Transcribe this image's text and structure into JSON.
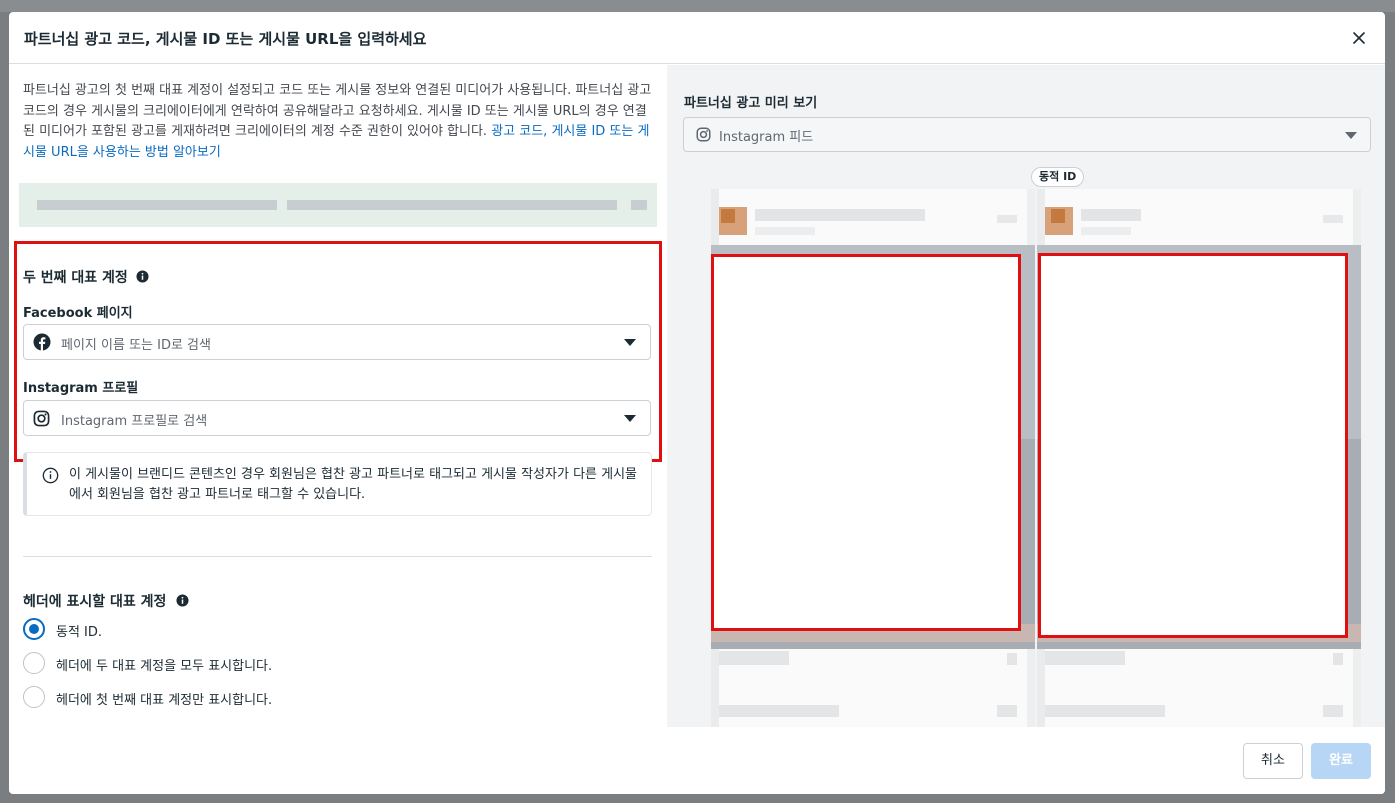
{
  "modal": {
    "title": "파트너십 광고 코드, 게시물 ID 또는 게시물 URL을 입력하세요",
    "intro_text": "파트너십 광고의 첫 번째 대표 계정이 설정되고 코드 또는 게시물 정보와 연결된 미디어가 사용됩니다. 파트너십 광고 코드의 경우 게시물의 크리에이터에게 연락하여 공유해달라고 요청하세요. 게시물 ID 또는 게시물 URL의 경우 연결된 미디어가 포함된 광고를 게재하려면 크리에이터의 계정 수준 권한이 있어야 합니다. ",
    "intro_link": "광고 코드, 게시물 ID 또는 게시물 URL을 사용하는 방법 알아보기"
  },
  "second_account": {
    "title": "두 번째 대표 계정",
    "facebook_label": "Facebook 페이지",
    "facebook_placeholder": "페이지 이름 또는 ID로 검색",
    "instagram_label": "Instagram 프로필",
    "instagram_placeholder": "Instagram 프로필로 검색"
  },
  "info": {
    "text": "이 게시물이 브랜디드 콘텐츠인 경우 회원님은 협찬 광고 파트너로 태그되고 게시물 작성자가 다른 게시물에서 회원님을 협찬 광고 파트너로 태그할 수 있습니다."
  },
  "header_account": {
    "title": "헤더에 표시할 대표 계정",
    "options": [
      {
        "label": "동적 ID.",
        "selected": true
      },
      {
        "label": "헤더에 두 대표 계정을 모두 표시합니다.",
        "selected": false
      },
      {
        "label": "헤더에 첫 번째 대표 계정만 표시합니다.",
        "selected": false
      }
    ]
  },
  "preview": {
    "title": "파트너십 광고 미리 보기",
    "placement": "Instagram 피드",
    "badge": "동적 ID"
  },
  "footer": {
    "cancel_label": "취소",
    "done_label": "완료"
  },
  "colors": {
    "accent": "#0a6bc2",
    "highlight_border": "#e01010",
    "done_disabled": "#b7d6f5"
  }
}
